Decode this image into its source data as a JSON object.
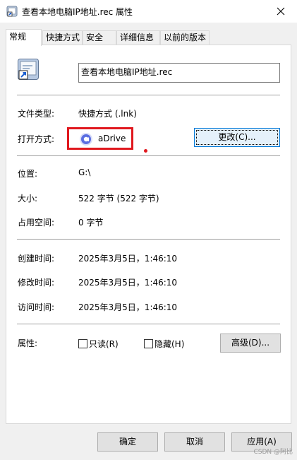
{
  "window": {
    "title": "查看本地电脑IP地址.rec 属性",
    "close_icon": "close-icon"
  },
  "tabs": [
    {
      "label": "常规",
      "active": true
    },
    {
      "label": "快捷方式"
    },
    {
      "label": "安全"
    },
    {
      "label": "详细信息"
    },
    {
      "label": "以前的版本"
    }
  ],
  "general": {
    "file_name": "查看本地电脑IP地址.rec",
    "file_type_label": "文件类型:",
    "file_type_value": "快捷方式 (.lnk)",
    "open_with_label": "打开方式:",
    "open_with_app": "aDrive",
    "change_button": "更改(C)...",
    "location_label": "位置:",
    "location_value": "G:\\",
    "size_label": "大小:",
    "size_value": "522 字节 (522 字节)",
    "size_on_disk_label": "占用空间:",
    "size_on_disk_value": "0 字节",
    "created_label": "创建时间:",
    "created_value": "2025年3月5日，1:46:10",
    "modified_label": "修改时间:",
    "modified_value": "2025年3月5日，1:46:10",
    "accessed_label": "访问时间:",
    "accessed_value": "2025年3月5日，1:46:10",
    "attributes_label": "属性:",
    "readonly_label": "只读(R)",
    "hidden_label": "隐藏(H)",
    "advanced_button": "高级(D)..."
  },
  "footer": {
    "ok_button": "确定",
    "cancel_button": "取消",
    "apply_button": "应用(A)",
    "watermark": "CSDN @阿比"
  },
  "colors": {
    "highlight": "#e0181e",
    "accent": "#0078d7",
    "app_icon": "#5b6ee1"
  }
}
